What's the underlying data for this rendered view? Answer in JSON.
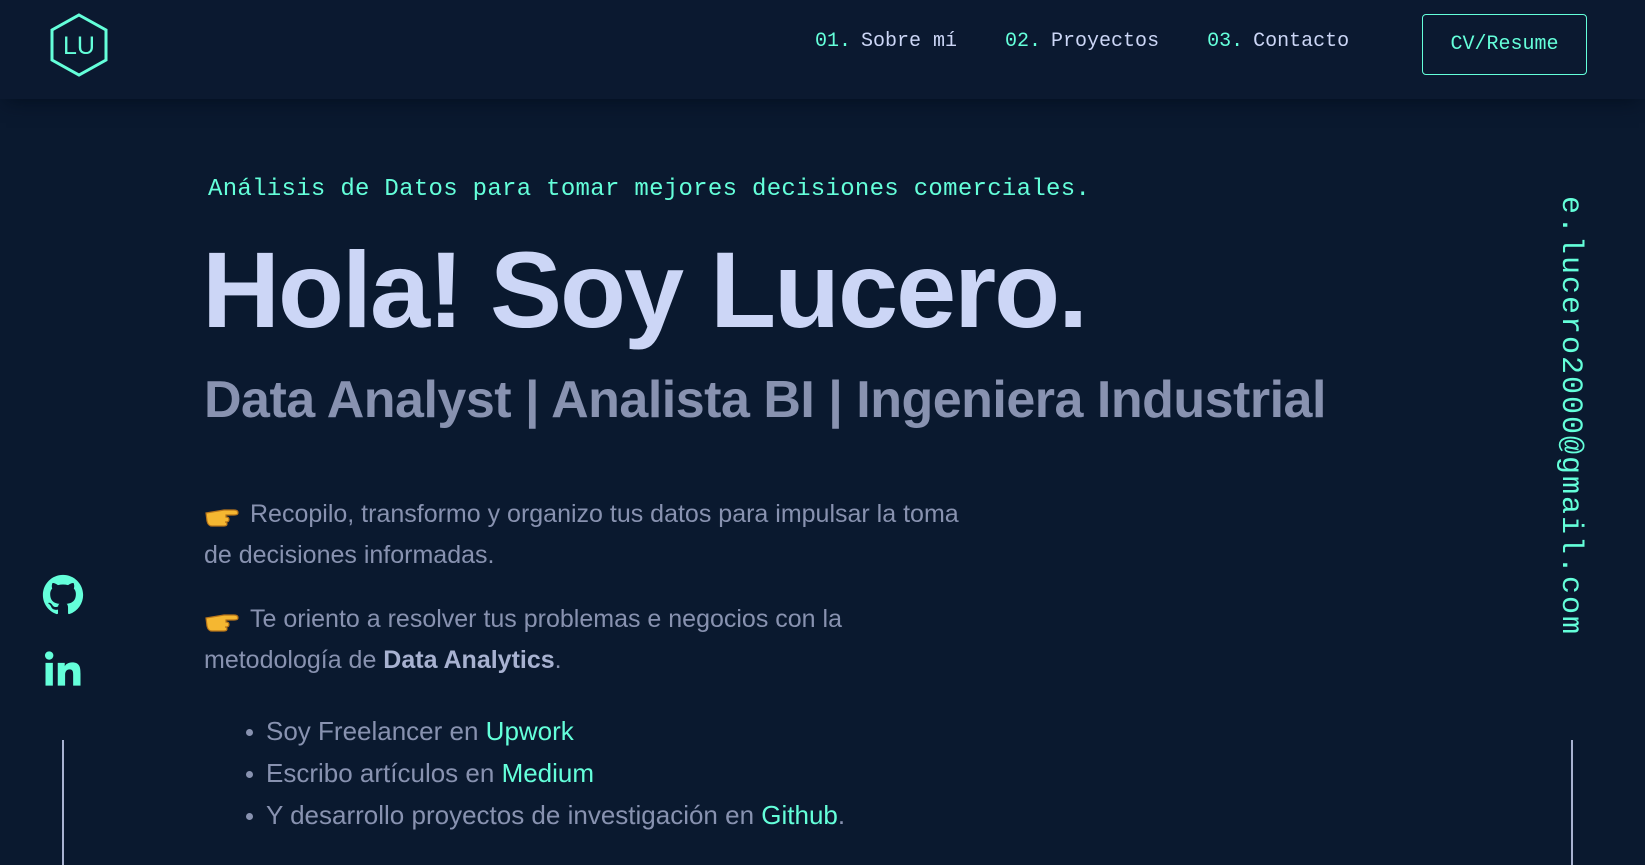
{
  "header": {
    "logo_text": "LU",
    "nav": [
      {
        "num": "01.",
        "label": "Sobre mí"
      },
      {
        "num": "02.",
        "label": "Proyectos"
      },
      {
        "num": "03.",
        "label": "Contacto"
      }
    ],
    "resume_label": "CV/Resume"
  },
  "hero": {
    "tagline": "Análisis de Datos para tomar mejores decisiones comerciales.",
    "title": "Hola! Soy Lucero.",
    "subtitle": "Data Analyst | Analista BI | Ingeniera Industrial",
    "para1": "Recopilo, transformo y organizo tus datos para impulsar la toma de decisiones informadas.",
    "para2_prefix": "Te oriento a resolver tus problemas e negocios con la metodología de ",
    "para2_bold": "Data Analytics",
    "para2_suffix": ".",
    "bullets": [
      {
        "text": "Soy Freelancer en ",
        "link": "Upwork",
        "suffix": ""
      },
      {
        "text": "Escribo artículos en ",
        "link": "Medium",
        "suffix": ""
      },
      {
        "text": "Y desarrollo proyectos de investigación en ",
        "link": "Github",
        "suffix": "."
      }
    ]
  },
  "sidebar": {
    "email": "e.lucero2000@gmail.com",
    "social": [
      "github-icon",
      "linkedin-icon"
    ]
  },
  "colors": {
    "background": "#0a192f",
    "accent": "#64ffda",
    "heading": "#ccd6f6",
    "body_text": "#8892b0"
  }
}
